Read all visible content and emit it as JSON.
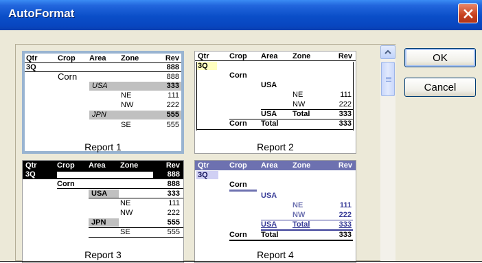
{
  "window": {
    "title": "AutoFormat"
  },
  "buttons": {
    "ok": "OK",
    "cancel": "Cancel"
  },
  "headers": [
    "Qtr",
    "Crop",
    "Area",
    "Zone",
    "Rev"
  ],
  "reports": [
    {
      "caption": "Report 1",
      "qtr": "3Q",
      "qtr_rev": "888",
      "crop": "Corn",
      "crop_rev": "888",
      "area1": "USA",
      "area1_rev": "333",
      "zone1": "NE",
      "zone1_rev": "111",
      "zone2": "NW",
      "zone2_rev": "222",
      "area2": "JPN",
      "area2_rev": "555",
      "zone3": "SE",
      "zone3_rev": "555"
    },
    {
      "caption": "Report 2",
      "qtr": "3Q",
      "crop": "Corn",
      "area": "USA",
      "zone1": "NE",
      "zone1_rev": "111",
      "zone2": "NW",
      "zone2_rev": "222",
      "subtotal_area": "USA",
      "subtotal_label": "Total",
      "subtotal_rev": "333",
      "total_crop": "Corn",
      "total_label": "Total",
      "total_rev": "333"
    },
    {
      "caption": "Report 3",
      "qtr": "3Q",
      "qtr_rev": "888",
      "crop": "Corn",
      "crop_rev": "888",
      "area1": "USA",
      "area1_rev": "333",
      "zone1": "NE",
      "zone1_rev": "111",
      "zone2": "NW",
      "zone2_rev": "222",
      "area2": "JPN",
      "area2_rev": "555",
      "zone3": "SE",
      "zone3_rev": "555"
    },
    {
      "caption": "Report 4",
      "qtr": "3Q",
      "crop": "Corn",
      "area": "USA",
      "zone1": "NE",
      "zone1_rev": "111",
      "zone2": "NW",
      "zone2_rev": "222",
      "subtotal_area": "USA",
      "subtotal_label": "Total",
      "subtotal_rev": "333",
      "total_crop": "Corn",
      "total_label": "Total",
      "total_rev": "333"
    }
  ],
  "colors": {
    "title_bar": "#0a4ec8",
    "close_button": "#c6401e",
    "selected_border": "#99b4d1",
    "report4_header": "#6d71b0",
    "report2_highlight": "#ffffc0"
  }
}
